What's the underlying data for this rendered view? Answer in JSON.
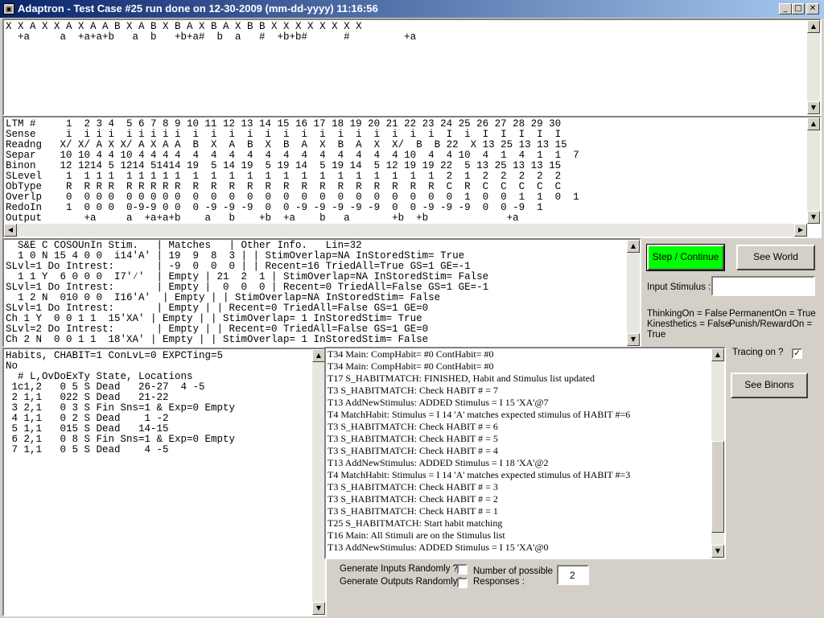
{
  "window": {
    "title": "Adaptron - Test Case #25 run done on 12-30-2009 (mm-dd-yyyy) 11:16:56"
  },
  "sequence_text": "X X A X X A X A A B X A B X B A X B A X B B X X X X X X X X\n  +a     a  +a+a+b   a  b   +b+a#  b  a   #  +b+b#      #         +a",
  "ltm_text": "LTM #     1  2 3 4  5 6 7 8 9 10 11 12 13 14 15 16 17 18 19 20 21 22 23 24 25 26 27 28 29 30\nSense     i  i i i  i i i i i  i  i  i  i  i  i  i  i  i  i  i  i  i  i  I  i  I  I  I  I  I\nReadng   X/ X/ A X X/ A X A A  B  X  A  B  X  B  A  X  B  A  X  X/  B  B 22  X 13 25 13 13 15\nSepar    10 10 4 4 10 4 4 4 4  4  4  4  4  4  4  4  4  4  4  4  4 10  4  4 10  4  1  4  1  1  7\nBinon    12 1214 5 1214 51414 19  5 14 19  5 19 14  5 19 14  5 12 19 19 22  5 13 25 13 13 15\nSLevel    1  1 1 1  1 1 1 1 1  1  1  1  1  1  1  1  1  1  1  1  1  1  1  2  1  2  2  2  2  2\nObType    R  R R R  R R R R R  R  R  R  R  R  R  R  R  R  R  R  R  R  R  C  R  C  C  C  C  C\nOverlp    0  0 0 0  0 0 0 0 0  0  0  0  0  0  0  0  0  0  0  0  0  0  0  0  1  0  0  1  1  0  1\nRedoIn    1  0 0 0  0-9-9 0 0  0 -9 -9 -9  0  0 -9 -9 -9 -9 -9  0  0 -9 -9 -9  0  0 -9  1\nOutput       +a     a  +a+a+b    a   b    +b  +a    b   a       +b  +b             +a",
  "se_text": "  S&E C COSOUnIn Stim.   | Matches   | Other Info.   Lin=32\n  1 0 N 15 4 0 0  i14'A' | 19  9  8  3 | | StimOverlap=NA InStoredStim= True\nSLvl=1 Do Intrest:       | -9  0  0  0 | | Recent=16 TriedAll=True GS=1 GE=-1\n  1 1 Y  6 0 0 0  I7'⁄'  | Empty | 21  2  1 | StimOverlap=NA InStoredStim= False\nSLvl=1 Do Intrest:       | Empty |  0  0  0 | Recent=0 TriedAll=False GS=1 GE=-1\n  1 2 N  010 0 0  I16'A'  | Empty | | StimOverlap=NA InStoredStim= False\nSLvl=1 Do Intrest:       | Empty | | Recent=0 TriedAll=False GS=1 GE=0\nCh 1 Y  0 0 1 1  15'XA' | Empty | | StimOverlap= 1 InStoredStim= True\nSLvl=2 Do Intrest:       | Empty | | Recent=0 TriedAll=False GS=1 GE=0\nCh 2 N  0 0 1 1  18'XA' | Empty | | StimOverlap= 1 InStoredStim= False",
  "habits_text": "Habits, CHABIT=1 ConLvL=0 EXPCTing=5\nNo\n  # L,OvDoExTy State, Locations\n 1c1,2   0 5 S Dead   26-27  4 -5\n 2 1,1   022 S Dead   21-22\n 3 2,1   0 3 S Fin Sns=1 & Exp=0 Empty\n 4 1,1   0 2 S Dead    1 -2\n 5 1,1   015 S Dead   14-15\n 6 2,1   0 8 S Fin Sns=1 & Exp=0 Empty\n 7 1,1   0 5 S Dead    4 -5",
  "trace_lines": [
    "T34 Main: CompHabit= #0 ContHabit= #0",
    "T34 Main: CompHabit= #0 ContHabit= #0",
    "T17 S_HABITMATCH: FINISHED, Habit and Stimulus list updated",
    "T3 S_HABITMATCH: Check HABIT # = 7",
    "T13 AddNewStimulus: ADDED  Stimulus = I 15 'XA'@7",
    "T4 MatchHabit:  Stimulus = I 14 'A' matches expected stimulus of HABIT #=6",
    "T3 S_HABITMATCH: Check HABIT # = 6",
    "T3 S_HABITMATCH: Check HABIT # = 5",
    "T3 S_HABITMATCH: Check HABIT # = 4",
    "T13 AddNewStimulus: ADDED  Stimulus = I 18 'XA'@2",
    "T4 MatchHabit:  Stimulus = I 14 'A' matches expected stimulus of HABIT #=3",
    "T3 S_HABITMATCH: Check HABIT # = 3",
    "T3 S_HABITMATCH: Check HABIT # = 2",
    "T3 S_HABITMATCH: Check HABIT # = 1",
    "T25 S_HABITMATCH: Start habit matching",
    "T16 Main: All Stimuli are on the Stimulus list",
    "T13 AddNewStimulus: ADDED  Stimulus = I 15 'XA'@0"
  ],
  "controls": {
    "step_continue": "Step / Continue",
    "see_world": "See World",
    "input_stimulus_label": "Input Stimulus :",
    "input_stimulus_value": "",
    "thinking": "ThinkingOn = False",
    "permanent": "PermanentOn = True",
    "kinesthetics": "Kinesthetics = False",
    "punish": "Punish/RewardOn =",
    "punish_value": "True",
    "tracing_label": "Tracing on ?",
    "tracing_checked": "✓",
    "see_binons": "See Binons",
    "gen_inputs": "Generate Inputs Randomly ?",
    "gen_outputs": "Generate Outputs Randomly?",
    "num_possible_line1": "Number of possible",
    "num_possible_line2": "Responses :",
    "num_possible_value": "2"
  },
  "colors": {
    "step_button": "#00ff00",
    "titlebar": "#0a246a"
  }
}
